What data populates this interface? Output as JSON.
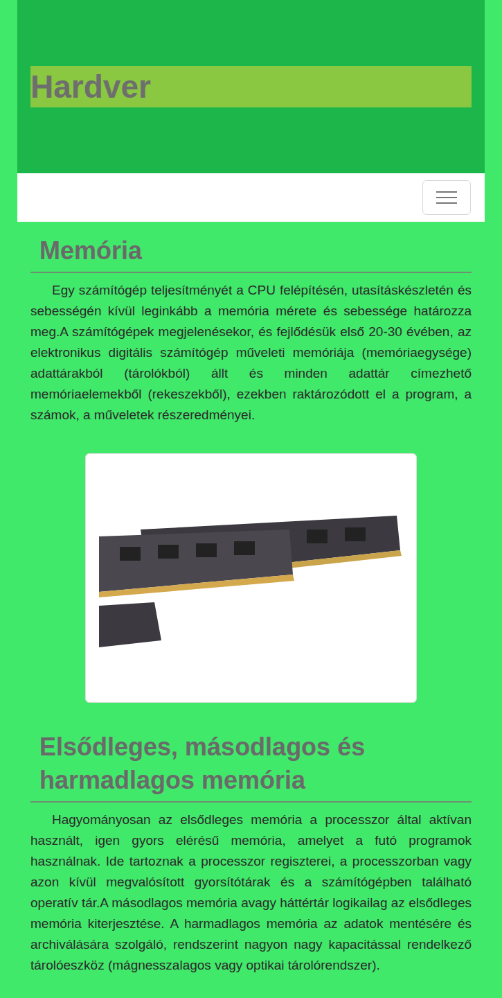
{
  "header": {
    "title": "Hardver"
  },
  "sections": [
    {
      "heading": "Memória",
      "paragraph": "Egy számítógép teljesítményét a CPU felépítésén, utasításkészletén és sebességén kívül leginkább a memória mérete és sebessége határozza meg.A számítógépek megjelenésekor, és fejlődésük első 20-30 évében, az elektronikus digitális számítógép műveleti memóriája (memóriaegysége) adattárakból (tárolókból) állt és minden adattár címezhető memóriaelemekből (rekeszekből), ezekben raktározódott el a program, a számok, a műveletek részeredményei.",
      "image": true
    },
    {
      "heading": "Elsődleges, másodlagos és harmadlagos memória",
      "paragraph": "Hagyományosan az elsődleges memória a processzor által aktívan használt, igen gyors elérésű memória, amelyet a futó programok használnak. Ide tartoznak a processzor regiszterei, a processzorban vagy azon kívül megvalósított gyorsítótárak és a számítógépben található operatív tár.A másodlagos memória avagy háttértár logikailag az elsődleges memória kiterjesztése. A harmadlagos memória az adatok mentésére és archiválására szolgáló, rendszerint nagyon nagy kapacitással rendelkező tárolóeszköz (mágnesszalagos vagy optikai tárolórendszer).",
      "image": false
    }
  ]
}
